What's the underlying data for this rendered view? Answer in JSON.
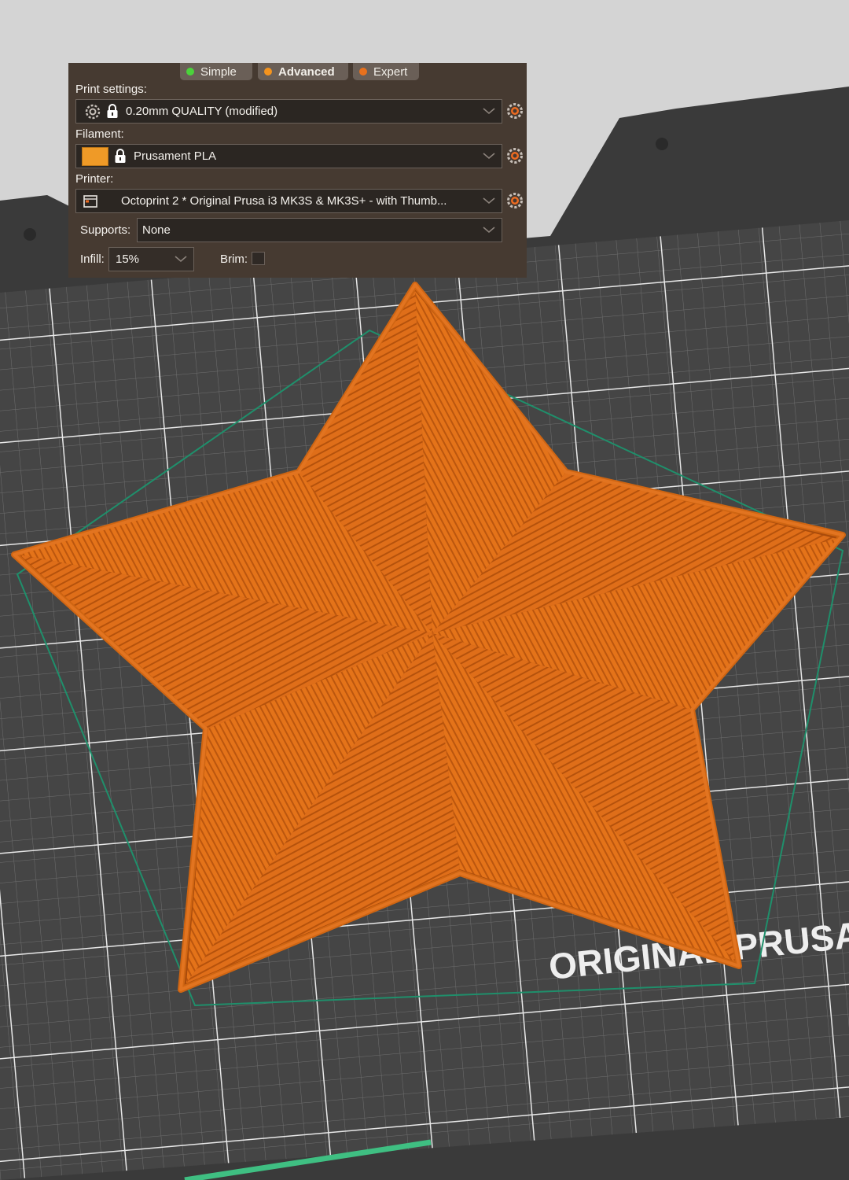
{
  "modes": [
    {
      "label": "Simple",
      "color": "#4bd23b",
      "active": false
    },
    {
      "label": "Advanced",
      "color": "#f5941e",
      "active": true
    },
    {
      "label": "Expert",
      "color": "#e8711d",
      "active": false
    }
  ],
  "print_settings": {
    "label": "Print settings:",
    "value": "0.20mm QUALITY (modified)"
  },
  "filament": {
    "label": "Filament:",
    "value": "Prusament PLA",
    "color": "#ef9a27"
  },
  "printer": {
    "label": "Printer:",
    "value": "Octoprint 2 * Original Prusa i3 MK3S & MK3S+ - with Thumb..."
  },
  "supports": {
    "label": "Supports:",
    "value": "None"
  },
  "infill": {
    "label": "Infill:",
    "value": "15%"
  },
  "brim": {
    "label": "Brim:",
    "checked": false
  },
  "bed": {
    "text": "ORIGINAL PRUSA"
  },
  "colors": {
    "accent": "#ed6b21",
    "model": "#e06f1a",
    "hull": "#1f8f6b"
  }
}
